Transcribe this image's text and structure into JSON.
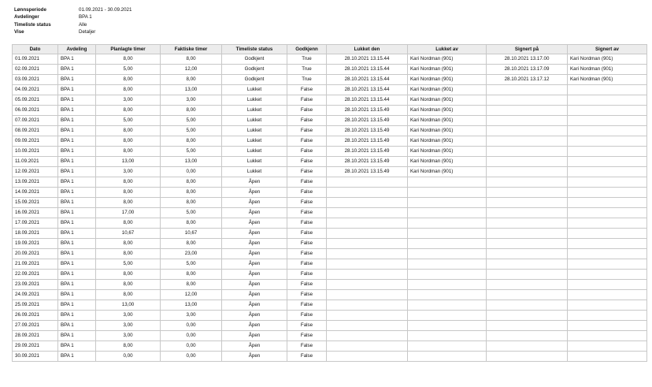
{
  "meta": [
    {
      "label": "Lønnsperiode",
      "value": "01.09.2021 - 30.09.2021"
    },
    {
      "label": "Avdelinger",
      "value": "BPA 1"
    },
    {
      "label": "Timeliste status",
      "value": "Alle"
    },
    {
      "label": "Vise",
      "value": "Detaljer"
    }
  ],
  "table": {
    "headers": [
      "Dato",
      "Avdeling",
      "Planlagte timer",
      "Faktiske timer",
      "Timeliste status",
      "Godkjenn",
      "Lukket den",
      "Lukket av",
      "Signert på",
      "Signert av"
    ],
    "rows": [
      [
        "01.09.2021",
        "BPA 1",
        "8,00",
        "8,00",
        "Godkjent",
        "True",
        "28.10.2021 13.15.44",
        "Kari Nordman (901)",
        "28.10.2021 13.17.00",
        "Kari Nordman (901)"
      ],
      [
        "02.09.2021",
        "BPA 1",
        "5,00",
        "12,00",
        "Godkjent",
        "True",
        "28.10.2021 13.15.44",
        "Kari Nordman (901)",
        "28.10.2021 13.17.09",
        "Kari Nordman (901)"
      ],
      [
        "03.09.2021",
        "BPA 1",
        "8,00",
        "8,00",
        "Godkjent",
        "True",
        "28.10.2021 13.15.44",
        "Kari Nordman (901)",
        "28.10.2021 13.17.12",
        "Kari Nordman (901)"
      ],
      [
        "04.09.2021",
        "BPA 1",
        "8,00",
        "13,00",
        "Lukket",
        "False",
        "28.10.2021 13.15.44",
        "Kari Nordman (901)",
        "",
        ""
      ],
      [
        "05.09.2021",
        "BPA 1",
        "3,00",
        "3,00",
        "Lukket",
        "False",
        "28.10.2021 13.15.44",
        "Kari Nordman (901)",
        "",
        ""
      ],
      [
        "06.09.2021",
        "BPA 1",
        "8,00",
        "8,00",
        "Lukket",
        "False",
        "28.10.2021 13.15.49",
        "Kari Nordman (901)",
        "",
        ""
      ],
      [
        "07.09.2021",
        "BPA 1",
        "5,00",
        "5,00",
        "Lukket",
        "False",
        "28.10.2021 13.15.49",
        "Kari Nordman (901)",
        "",
        ""
      ],
      [
        "08.09.2021",
        "BPA 1",
        "8,00",
        "5,00",
        "Lukket",
        "False",
        "28.10.2021 13.15.49",
        "Kari Nordman (901)",
        "",
        ""
      ],
      [
        "09.09.2021",
        "BPA 1",
        "8,00",
        "8,00",
        "Lukket",
        "False",
        "28.10.2021 13.15.49",
        "Kari Nordman (901)",
        "",
        ""
      ],
      [
        "10.09.2021",
        "BPA 1",
        "8,00",
        "5,00",
        "Lukket",
        "False",
        "28.10.2021 13.15.49",
        "Kari Nordman (901)",
        "",
        ""
      ],
      [
        "11.09.2021",
        "BPA 1",
        "13,00",
        "13,00",
        "Lukket",
        "False",
        "28.10.2021 13.15.49",
        "Kari Nordman (901)",
        "",
        ""
      ],
      [
        "12.09.2021",
        "BPA 1",
        "3,00",
        "0,00",
        "Lukket",
        "False",
        "28.10.2021 13.15.49",
        "Kari Nordman (901)",
        "",
        ""
      ],
      [
        "13.09.2021",
        "BPA 1",
        "8,00",
        "8,00",
        "Åpen",
        "False",
        "",
        "",
        "",
        ""
      ],
      [
        "14.09.2021",
        "BPA 1",
        "8,00",
        "8,00",
        "Åpen",
        "False",
        "",
        "",
        "",
        ""
      ],
      [
        "15.09.2021",
        "BPA 1",
        "8,00",
        "8,00",
        "Åpen",
        "False",
        "",
        "",
        "",
        ""
      ],
      [
        "16.09.2021",
        "BPA 1",
        "17,00",
        "5,00",
        "Åpen",
        "False",
        "",
        "",
        "",
        ""
      ],
      [
        "17.09.2021",
        "BPA 1",
        "8,00",
        "8,00",
        "Åpen",
        "False",
        "",
        "",
        "",
        ""
      ],
      [
        "18.09.2021",
        "BPA 1",
        "10,67",
        "10,67",
        "Åpen",
        "False",
        "",
        "",
        "",
        ""
      ],
      [
        "19.09.2021",
        "BPA 1",
        "8,00",
        "8,00",
        "Åpen",
        "False",
        "",
        "",
        "",
        ""
      ],
      [
        "20.09.2021",
        "BPA 1",
        "8,00",
        "23,00",
        "Åpen",
        "False",
        "",
        "",
        "",
        ""
      ],
      [
        "21.09.2021",
        "BPA 1",
        "5,00",
        "5,00",
        "Åpen",
        "False",
        "",
        "",
        "",
        ""
      ],
      [
        "22.09.2021",
        "BPA 1",
        "8,00",
        "8,00",
        "Åpen",
        "False",
        "",
        "",
        "",
        ""
      ],
      [
        "23.09.2021",
        "BPA 1",
        "8,00",
        "8,00",
        "Åpen",
        "False",
        "",
        "",
        "",
        ""
      ],
      [
        "24.09.2021",
        "BPA 1",
        "8,00",
        "12,00",
        "Åpen",
        "False",
        "",
        "",
        "",
        ""
      ],
      [
        "25.09.2021",
        "BPA 1",
        "13,00",
        "13,00",
        "Åpen",
        "False",
        "",
        "",
        "",
        ""
      ],
      [
        "26.09.2021",
        "BPA 1",
        "3,00",
        "3,00",
        "Åpen",
        "False",
        "",
        "",
        "",
        ""
      ],
      [
        "27.09.2021",
        "BPA 1",
        "3,00",
        "0,00",
        "Åpen",
        "False",
        "",
        "",
        "",
        ""
      ],
      [
        "28.09.2021",
        "BPA 1",
        "3,00",
        "0,00",
        "Åpen",
        "False",
        "",
        "",
        "",
        ""
      ],
      [
        "29.09.2021",
        "BPA 1",
        "8,00",
        "0,00",
        "Åpen",
        "False",
        "",
        "",
        "",
        ""
      ],
      [
        "30.09.2021",
        "BPA 1",
        "0,00",
        "0,00",
        "Åpen",
        "False",
        "",
        "",
        "",
        ""
      ]
    ]
  },
  "colors": {
    "grid": "#c8c8c8",
    "header_bg": "#ececec"
  }
}
